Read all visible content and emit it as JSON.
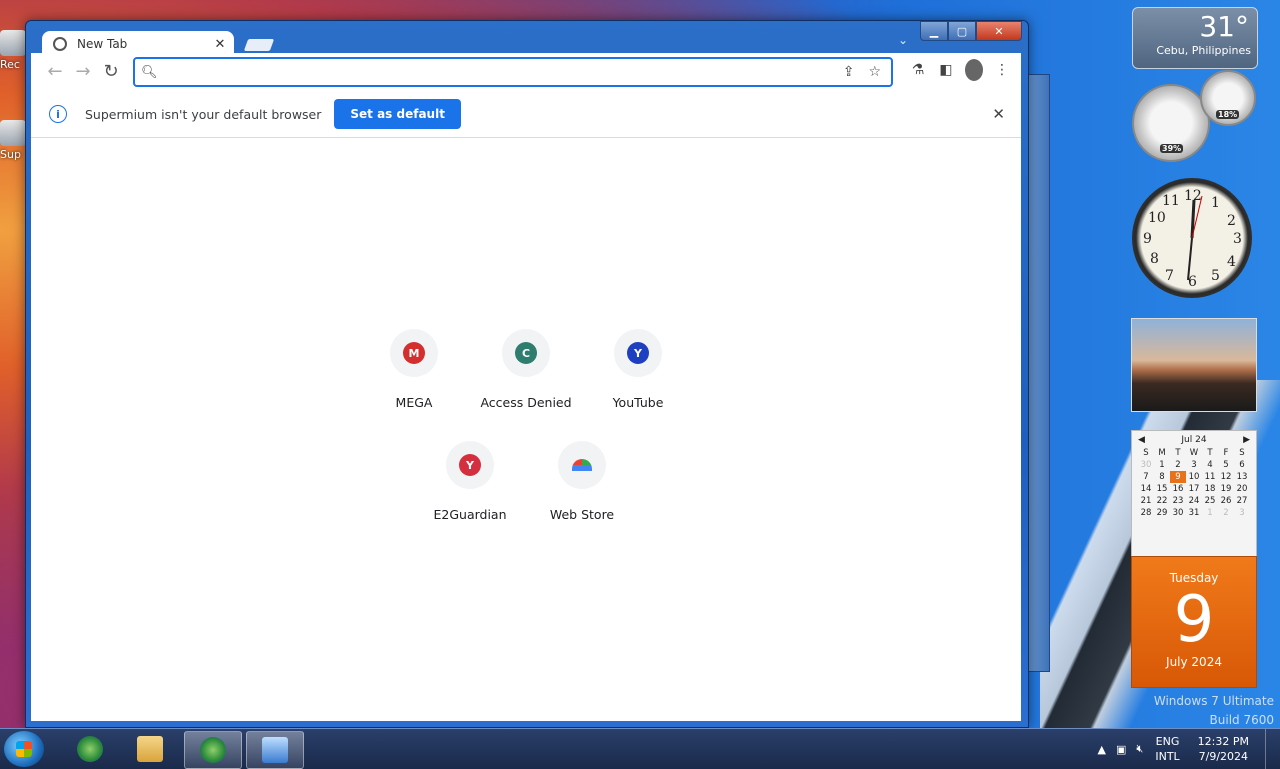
{
  "browser": {
    "tab_title": "New Tab",
    "tab_close": "✕",
    "omnibox_placeholder": "",
    "infobar_text": "Supermium isn't your default browser",
    "set_default_label": "Set as default",
    "infobar_close": "✕",
    "shortcuts": [
      {
        "label": "MEGA",
        "letter": "M",
        "color": "#d32f2f"
      },
      {
        "label": "Access Denied",
        "letter": "C",
        "color": "#2e7d6f"
      },
      {
        "label": "YouTube",
        "letter": "Y",
        "color": "#1e3fbf"
      },
      {
        "label": "E2Guardian",
        "letter": "Y",
        "color": "#d32f3f"
      },
      {
        "label": "Web Store",
        "letter": "",
        "color": "#4285f4"
      }
    ]
  },
  "window_controls": {
    "minimize": "▁",
    "maximize": "▢",
    "close": "✕"
  },
  "desktop": {
    "icons": [
      {
        "label": "Rec"
      },
      {
        "label": "Sup"
      }
    ],
    "watermark_line1": "Windows 7 Ultimate",
    "watermark_line2": "Build 7600"
  },
  "gadgets": {
    "weather": {
      "temp": "31°",
      "location": "Cebu, Philippines"
    },
    "cpu_meter": {
      "cpu": "39%",
      "memory": "18%"
    },
    "clock": {
      "numbers": [
        "12",
        "1",
        "2",
        "3",
        "4",
        "5",
        "6",
        "7",
        "8",
        "9",
        "10",
        "11"
      ]
    },
    "calendar": {
      "month_label": "Jul 24",
      "weekdays": [
        "S",
        "M",
        "T",
        "W",
        "T",
        "F",
        "S"
      ],
      "weeks": [
        [
          "30",
          "1",
          "2",
          "3",
          "4",
          "5",
          "6"
        ],
        [
          "7",
          "8",
          "9",
          "10",
          "11",
          "12",
          "13"
        ],
        [
          "14",
          "15",
          "16",
          "17",
          "18",
          "19",
          "20"
        ],
        [
          "21",
          "22",
          "23",
          "24",
          "25",
          "26",
          "27"
        ],
        [
          "28",
          "29",
          "30",
          "31",
          "1",
          "2",
          "3"
        ]
      ],
      "today": "9",
      "day_name": "Tuesday",
      "day_number": "9",
      "month_year": "July 2024"
    }
  },
  "taskbar": {
    "tray": {
      "lang_top": "ENG",
      "lang_bottom": "INTL",
      "time": "12:32 PM",
      "date": "7/9/2024"
    }
  }
}
